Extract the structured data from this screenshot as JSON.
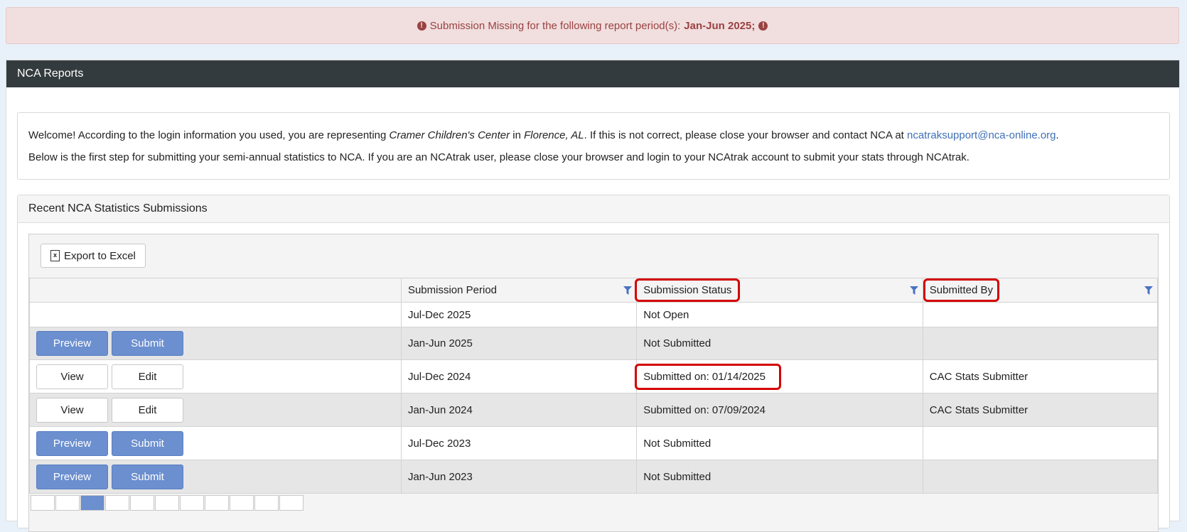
{
  "alert": {
    "text": "Submission Missing for the following report period(s):",
    "periods": "Jan-Jun 2025;"
  },
  "panel": {
    "title": "NCA Reports"
  },
  "welcome": {
    "p1_a": "Welcome! According to the login information you used, you are representing ",
    "org": "Cramer Children's Center",
    "p1_b": " in ",
    "location": "Florence, AL",
    "p1_c": ". If this is not correct, please close your browser and contact NCA at ",
    "email": "ncatraksupport@nca-online.org",
    "p1_d": ".",
    "p2": "Below is the first step for submitting your semi-annual statistics to NCA. If you are an NCAtrak user, please close your browser and login to your NCAtrak account to submit your stats through NCAtrak."
  },
  "recent": {
    "title": "Recent NCA Statistics Submissions"
  },
  "grid": {
    "export_label": "Export to Excel",
    "columns": [
      "Submission Period",
      "Submission Status",
      "Submitted By"
    ],
    "preview_label": "Preview",
    "submit_label": "Submit",
    "view_label": "View",
    "edit_label": "Edit",
    "rows": [
      {
        "period": "Jul-Dec 2025",
        "status": "Not Open",
        "by": ""
      },
      {
        "period": "Jan-Jun 2025",
        "status": "Not Submitted",
        "by": ""
      },
      {
        "period": "Jul-Dec 2024",
        "status": "Submitted on: 01/14/2025",
        "by": "CAC Stats Submitter"
      },
      {
        "period": "Jan-Jun 2024",
        "status": "Submitted on: 07/09/2024",
        "by": "CAC Stats Submitter"
      },
      {
        "period": "Jul-Dec 2023",
        "status": "Not Submitted",
        "by": ""
      },
      {
        "period": "Jan-Jun 2023",
        "status": "Not Submitted",
        "by": ""
      }
    ]
  },
  "colors": {
    "alert_text": "#9a4242",
    "header_bg": "#343b3e",
    "primary": "#6b8fcf",
    "highlight": "#d40000"
  }
}
